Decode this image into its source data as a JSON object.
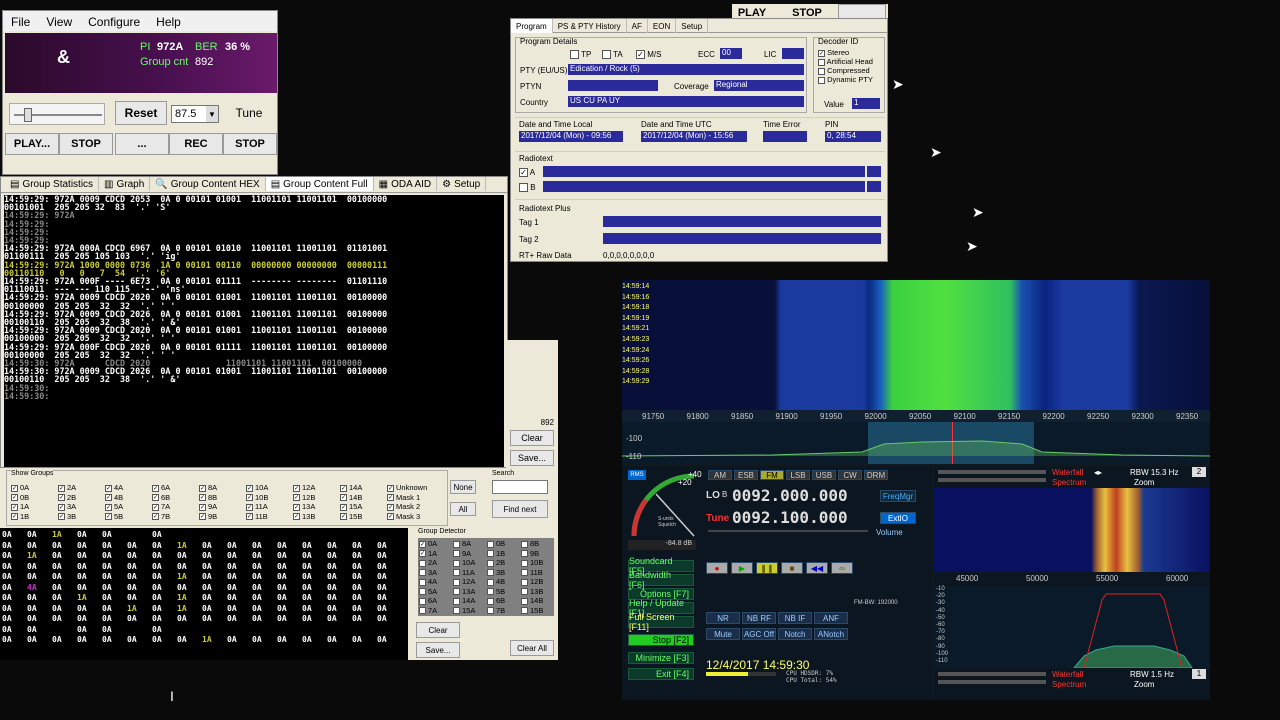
{
  "rds_main": {
    "menu": [
      "File",
      "View",
      "Configure",
      "Help"
    ],
    "ps": "&",
    "pi_label": "PI",
    "pi_value": "972A",
    "ber_label": "BER",
    "ber_value": "36 %",
    "group_cnt_label": "Group cnt",
    "group_cnt_value": "892",
    "reset": "Reset",
    "freq": "87.5",
    "tune": "Tune",
    "play": "PLAY...",
    "stop": "STOP",
    "dots": "...",
    "rec": "REC",
    "stop2": "STOP"
  },
  "top_buttons": {
    "play": "PLAY",
    "stop": "STOP"
  },
  "group_tabs": [
    "Group Statistics",
    "Graph",
    "Group Content HEX",
    "Group Content Full",
    "ODA AID",
    "Setup"
  ],
  "group_log": [
    {
      "t": "14:59:29:",
      "text": " 972A 0009 CDCD 2053  0A 0 00101 01001  11001101 11001101  00100000",
      "c": "w"
    },
    {
      "t": "",
      "text": "00101001  205 205 32  83  '.' 'S'",
      "c": "w"
    },
    {
      "t": "14:59:29:",
      "text": " 972A",
      "c": "g"
    },
    {
      "t": "14:59:29:",
      "text": "",
      "c": "g"
    },
    {
      "t": "14:59:29:",
      "text": "",
      "c": "g"
    },
    {
      "t": "14:59:29:",
      "text": "",
      "c": "g"
    },
    {
      "t": "14:59:29:",
      "text": " 972A 000A CDCD 6967  0A 0 00101 01010  11001101 11001101  01101001",
      "c": "w"
    },
    {
      "t": "",
      "text": "01100111  205 205 105 103  '.' 'ig'",
      "c": "w"
    },
    {
      "t": "14:59:29:",
      "text": " 972A 1000 0000 0736  1A 0 00101 00110  00000000 00000000  00000111",
      "c": "y"
    },
    {
      "t": "",
      "text": "00110110   0   0   7  54  '.' '6'",
      "c": "y"
    },
    {
      "t": "14:59:29:",
      "text": " 972A 000F ---- 6E73  0A 0 00101 01111  -------- --------  01101110",
      "c": "w"
    },
    {
      "t": "",
      "text": "01110011  --- --- 110 115  '--' 'ns'",
      "c": "w"
    },
    {
      "t": "14:59:29:",
      "text": " 972A 0009 CDCD 2020  0A 0 00101 01001  11001101 11001101  00100000",
      "c": "w"
    },
    {
      "t": "",
      "text": "00100000  205 205  32  32  '.' ' '",
      "c": "w"
    },
    {
      "t": "14:59:29:",
      "text": " 972A 0009 CDCD 2026  0A 0 00101 01001  11001101 11001101  00100000",
      "c": "w"
    },
    {
      "t": "",
      "text": "00100110  205 205  32  38  '.' ' &'",
      "c": "w"
    },
    {
      "t": "14:59:29:",
      "text": " 972A 0009 CDCD 2020  0A 0 00101 01001  11001101 11001101  00100000",
      "c": "w"
    },
    {
      "t": "",
      "text": "00100000  205 205  32  32  '.' ' '",
      "c": "w"
    },
    {
      "t": "14:59:29:",
      "text": " 972A 000F CDCD 2020  0A 0 00101 01111  11001101 11001101  00100000",
      "c": "w"
    },
    {
      "t": "",
      "text": "00100000  205 205  32  32  '.' ' '",
      "c": "w"
    },
    {
      "t": "14:59:30:",
      "text": " 972A      CDCD 2020               11001101 11001101  00100000",
      "c": "g"
    },
    {
      "t": "14:59:30:",
      "text": " 972A 0009 CDCD 2026  0A 0 00101 01001  11001101 11001101  00100000",
      "c": "w"
    },
    {
      "t": "",
      "text": "00100110  205 205  32  38  '.' ' &'",
      "c": "w"
    },
    {
      "t": "14:59:30:",
      "text": "",
      "c": "g"
    },
    {
      "t": "14:59:30:",
      "text": "",
      "c": "g"
    }
  ],
  "group_side": {
    "count": "892",
    "clear": "Clear",
    "save": "Save..."
  },
  "show_groups": {
    "title": "Show Groups",
    "items": [
      "0A",
      "2A",
      "4A",
      "6A",
      "8A",
      "10A",
      "12A",
      "14A",
      "Unknown",
      "0B",
      "2B",
      "4B",
      "6B",
      "8B",
      "10B",
      "12B",
      "14B",
      "Mask 1",
      "1A",
      "3A",
      "5A",
      "7A",
      "9A",
      "11A",
      "13A",
      "15A",
      "Mask 2",
      "1B",
      "3B",
      "5B",
      "7B",
      "9B",
      "11B",
      "13B",
      "15B",
      "Mask 3"
    ],
    "none": "None",
    "all": "All",
    "search_title": "Search",
    "find_next": "Find next"
  },
  "grid_rows": [
    [
      "0A",
      "0A",
      "1A",
      "0A",
      "0A",
      "",
      "0A",
      "",
      "",
      "",
      "",
      "",
      "",
      "",
      "",
      ""
    ],
    [
      "0A",
      "0A",
      "0A",
      "0A",
      "0A",
      "0A",
      "0A",
      "1A",
      "0A",
      "0A",
      "0A",
      "0A",
      "0A",
      "0A",
      "0A",
      "0A"
    ],
    [
      "0A",
      "1A",
      "0A",
      "0A",
      "0A",
      "0A",
      "0A",
      "0A",
      "0A",
      "0A",
      "0A",
      "0A",
      "0A",
      "0A",
      "0A",
      "0A"
    ],
    [
      "0A",
      "0A",
      "0A",
      "0A",
      "0A",
      "0A",
      "0A",
      "0A",
      "0A",
      "0A",
      "0A",
      "0A",
      "0A",
      "0A",
      "0A",
      "0A"
    ],
    [
      "0A",
      "0A",
      "0A",
      "0A",
      "0A",
      "0A",
      "0A",
      "1A",
      "0A",
      "0A",
      "0A",
      "0A",
      "0A",
      "0A",
      "0A",
      "0A"
    ],
    [
      "0A",
      "4A",
      "0A",
      "0A",
      "0A",
      "0A",
      "0A",
      "0A",
      "0A",
      "0A",
      "0A",
      "0A",
      "0A",
      "0A",
      "0A",
      "0A"
    ],
    [
      "0A",
      "0A",
      "0A",
      "1A",
      "0A",
      "0A",
      "0A",
      "1A",
      "0A",
      "0A",
      "0A",
      "0A",
      "0A",
      "0A",
      "0A",
      "0A"
    ],
    [
      "0A",
      "0A",
      "0A",
      "0A",
      "0A",
      "1A",
      "0A",
      "1A",
      "0A",
      "0A",
      "0A",
      "0A",
      "0A",
      "0A",
      "0A",
      "0A"
    ],
    [
      "0A",
      "0A",
      "0A",
      "0A",
      "0A",
      "0A",
      "0A",
      "0A",
      "0A",
      "0A",
      "0A",
      "0A",
      "0A",
      "0A",
      "0A",
      "0A"
    ],
    [
      "0A",
      "0A",
      "",
      "0A",
      "0A",
      "",
      "0A",
      "",
      "",
      "",
      "",
      "",
      "",
      "",
      "",
      ""
    ],
    [
      "0A",
      "0A",
      "0A",
      "0A",
      "0A",
      "0A",
      "0A",
      "0A",
      "1A",
      "0A",
      "0A",
      "0A",
      "0A",
      "0A",
      "0A",
      "0A"
    ]
  ],
  "group_detector": {
    "title": "Group Detector",
    "items": [
      "0A",
      "8A",
      "0B",
      "8B",
      "1A",
      "9A",
      "1B",
      "9B",
      "2A",
      "10A",
      "2B",
      "10B",
      "3A",
      "11A",
      "3B",
      "11B",
      "4A",
      "12A",
      "4B",
      "12B",
      "5A",
      "13A",
      "5B",
      "13B",
      "6A",
      "14A",
      "6B",
      "14B",
      "7A",
      "15A",
      "7B",
      "15B"
    ],
    "clear": "Clear",
    "save": "Save...",
    "clear_all": "Clear All"
  },
  "decoder": {
    "tabs": [
      "Program",
      "PS & PTY History",
      "AF",
      "EON",
      "Setup"
    ],
    "program_details": "Program Details",
    "tp": "TP",
    "ta": "TA",
    "ms": "M/S",
    "ecc_label": "ECC",
    "ecc_value": "00",
    "lic_label": "LIC",
    "pty_label": "PTY (EU/US)",
    "pty_value": "Edication / Rock (5)",
    "ptyn_label": "PTYN",
    "coverage_label": "Coverage",
    "coverage_value": "Regional",
    "country_label": "Country",
    "country_value": "US CU PA UY",
    "decoder_id": "Decoder ID",
    "stereo": "Stereo",
    "artificial": "Artificial Head",
    "compressed": "Compressed",
    "dynamic": "Dynamic PTY",
    "value_label": "Value",
    "value": "1",
    "dt_local_label": "Date and Time Local",
    "dt_local": "2017/12/04 (Mon) - 09:56",
    "dt_utc_label": "Date and Time UTC",
    "dt_utc": "2017/12/04 (Mon) - 15:56",
    "time_error_label": "Time Error",
    "pin_label": "PIN",
    "pin": "0, 28:54",
    "radiotext": "Radiotext",
    "a": "A",
    "b": "B",
    "rtplus": "Radiotext Plus",
    "tag1": "Tag 1",
    "tag2": "Tag 2",
    "raw_label": "RT+ Raw Data",
    "raw": "0,0,0,0,0,0,0,0"
  },
  "sdr": {
    "times": [
      "14:59:14",
      "14:59:16",
      "14:59:18",
      "14:59:19",
      "14:59:21",
      "14:59:23",
      "14:59:24",
      "14:59:26",
      "14:59:28",
      "14:59:29"
    ],
    "freq_ticks": [
      "91750",
      "91800",
      "91850",
      "91900",
      "91950",
      "92000",
      "92050",
      "92100",
      "92150",
      "92200",
      "92250",
      "92300",
      "92350"
    ],
    "db_ticks": [
      "-100",
      "-110"
    ],
    "modes": [
      "AM",
      "ESB",
      "FM",
      "LSB",
      "USB",
      "CW",
      "DRM"
    ],
    "lo_label": "LO",
    "lo_freq": "0092.000.000",
    "tune_label": "Tune",
    "tune_freq": "0092.100.000",
    "freq_mgr": "FreqMgr",
    "extio": "ExtIO",
    "volume": "Volume",
    "rms": "RMS",
    "smeter_db": "-84.8 dB",
    "squelch": "S-units Squelch",
    "menu": [
      "Soundcard [F5]",
      "Bandwidth [F6]",
      "Options [F7]",
      "Help / Update [F1]",
      "Full Screen [F11]",
      "Stop [F2]",
      "Minimize [F3]",
      "Exit [F4]"
    ],
    "nb": [
      "NR",
      "NB RF",
      "NB IF",
      "ANF"
    ],
    "nb2": [
      "Mute",
      "AGC Off",
      "Notch",
      "ANotch"
    ],
    "fm_bw": "FM-BW: 192000",
    "datetime": "12/4/2017 14:59:30",
    "cpu_hdsdr": "CPU HDSDR: 7%",
    "cpu_total": "CPU Total: 54%",
    "waterfall": "Waterfall",
    "spectrum": "Spectrum",
    "rbw1": "RBW 15.3 Hz",
    "rbw2": "RBW 1.5 Hz",
    "zoom": "Zoom",
    "n1": "2",
    "n2": "1",
    "audio_ticks": [
      "45000",
      "50000",
      "55000",
      "60000"
    ],
    "audio_db": [
      "-10",
      "-20",
      "-30",
      "-40",
      "-50",
      "-60",
      "-70",
      "-80",
      "-90",
      "-100",
      "-110"
    ],
    "s_scale": [
      "+20",
      "+40"
    ]
  }
}
